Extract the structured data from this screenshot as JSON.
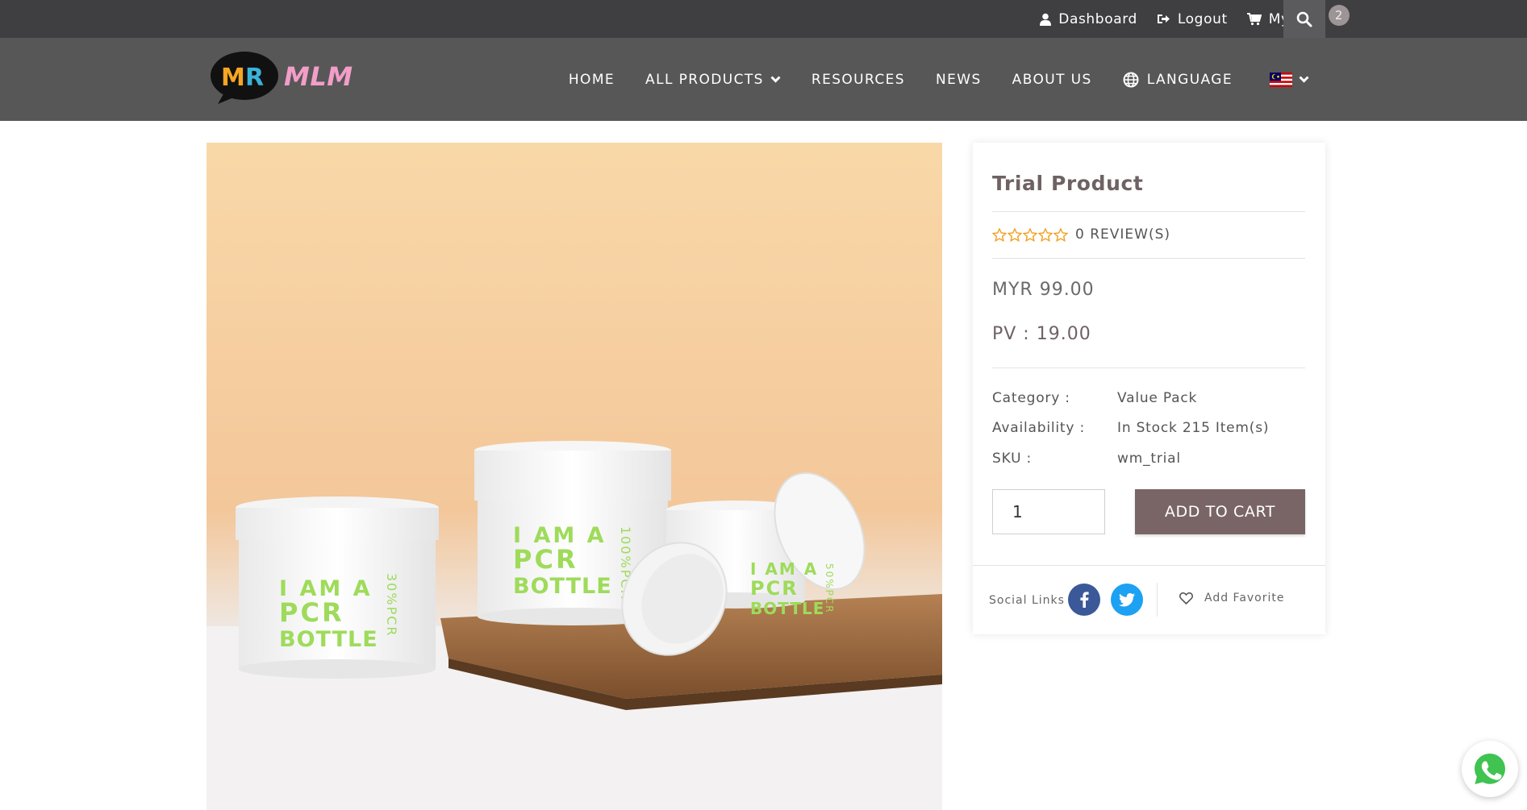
{
  "topbar": {
    "dashboard": "Dashboard",
    "logout": "Logout",
    "cart": "My Cart",
    "cart_count": "2"
  },
  "logo": {
    "mark": "MR",
    "text": "MLM"
  },
  "nav": {
    "home": "HOME",
    "all_products": "ALL PRODUCTS",
    "resources": "RESOURCES",
    "news": "NEWS",
    "about": "ABOUT US",
    "language": "LANGUAGE"
  },
  "product_image": {
    "jar_left": [
      "I AM A",
      "PCR",
      "BOTTLE",
      "30%PCR"
    ],
    "jar_middle": [
      "I AM A",
      "PCR",
      "BOTTLE",
      "100%PCR"
    ],
    "jar_right": [
      "I AM A",
      "PCR",
      "BOTTLE",
      "50%PCR"
    ]
  },
  "product": {
    "title": "Trial Product",
    "rating": 0,
    "reviews": "0 REVIEW(S)",
    "price": "MYR 99.00",
    "pv": "PV : 19.00",
    "info": [
      {
        "label": "Category :",
        "value": "Value Pack"
      },
      {
        "label": "Availability :",
        "value": "In Stock 215 Item(s)"
      },
      {
        "label": "SKU :",
        "value": "wm_trial"
      }
    ],
    "quantity": "1",
    "add_to_cart": "ADD TO CART"
  },
  "social": {
    "label": "Social Links",
    "favorite": "Add Favorite"
  },
  "colors": {
    "topbar": "#3f3f41",
    "navbar": "#575757",
    "button": "#7a6566",
    "star": "#f0a020",
    "facebook": "#3b5998",
    "twitter": "#1da1f2",
    "whatsapp": "#40c351"
  }
}
